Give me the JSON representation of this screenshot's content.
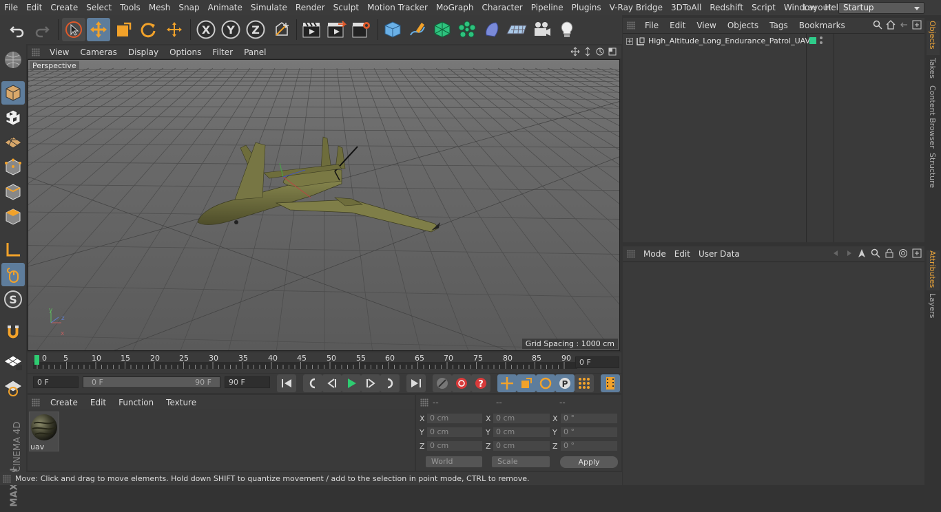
{
  "menubar": {
    "items": [
      "File",
      "Edit",
      "Create",
      "Select",
      "Tools",
      "Mesh",
      "Snap",
      "Animate",
      "Simulate",
      "Render",
      "Sculpt",
      "Motion Tracker",
      "MoGraph",
      "Character",
      "Pipeline",
      "Plugins",
      "V-Ray Bridge",
      "3DToAll",
      "Redshift",
      "Script",
      "Window",
      "Help"
    ],
    "layout_label": "Layout:",
    "layout_value": "Startup"
  },
  "toolbar": {
    "axis_x": "X",
    "axis_y": "Y",
    "axis_z": "Z"
  },
  "viewport": {
    "menu": [
      "View",
      "Cameras",
      "Display",
      "Options",
      "Filter",
      "Panel"
    ],
    "camera_label": "Perspective",
    "grid_spacing": "Grid Spacing : 1000 cm"
  },
  "timeline": {
    "ticks": [
      "0",
      "5",
      "10",
      "15",
      "20",
      "25",
      "30",
      "35",
      "40",
      "45",
      "50",
      "55",
      "60",
      "65",
      "70",
      "75",
      "80",
      "85",
      "90"
    ],
    "current_frame": "0 F"
  },
  "transport": {
    "start_field": "0 F",
    "range_start": "0 F",
    "range_end": "90 F",
    "end_field": "90 F"
  },
  "material_manager": {
    "menu": [
      "Create",
      "Edit",
      "Function",
      "Texture"
    ],
    "materials": [
      {
        "name": "uav"
      }
    ]
  },
  "coordinates": {
    "headers": [
      "--",
      "--",
      "--"
    ],
    "rows": [
      {
        "axis": "X",
        "pos": "0 cm",
        "size_axis": "X",
        "size": "0 cm",
        "rot_axis": "X",
        "rot": "0 °"
      },
      {
        "axis": "Y",
        "pos": "0 cm",
        "size_axis": "Y",
        "size": "0 cm",
        "rot_axis": "Y",
        "rot": "0 °"
      },
      {
        "axis": "Z",
        "pos": "0 cm",
        "size_axis": "Z",
        "size": "0 cm",
        "rot_axis": "Z",
        "rot": "0 °"
      }
    ],
    "space_select": "World",
    "mode_select": "Scale",
    "apply_label": "Apply"
  },
  "object_manager": {
    "menu": [
      "File",
      "Edit",
      "View",
      "Objects",
      "Tags",
      "Bookmarks"
    ],
    "objects": [
      {
        "name": "High_Altitude_Long_Endurance_Patrol_UAV",
        "layer_color": "#2ecc8a"
      }
    ]
  },
  "attribute_manager": {
    "menu": [
      "Mode",
      "Edit",
      "User Data"
    ]
  },
  "right_tabs": {
    "top": [
      "Objects",
      "Takes",
      "Content Browser",
      "Structure"
    ],
    "bottom": [
      "Attributes",
      "Layers"
    ]
  },
  "status": {
    "text": "Move: Click and drag to move elements. Hold down SHIFT to quantize movement / add to the selection in point mode, CTRL to remove."
  },
  "brand": {
    "line1": "MAXON",
    "line2": "CINEMA 4D"
  },
  "colors": {
    "accent_selected": "#5e7d9c",
    "active_tab": "#e8a33a",
    "uav_body": "#6b6a3a",
    "timeline_marker": "#2ecc71"
  }
}
